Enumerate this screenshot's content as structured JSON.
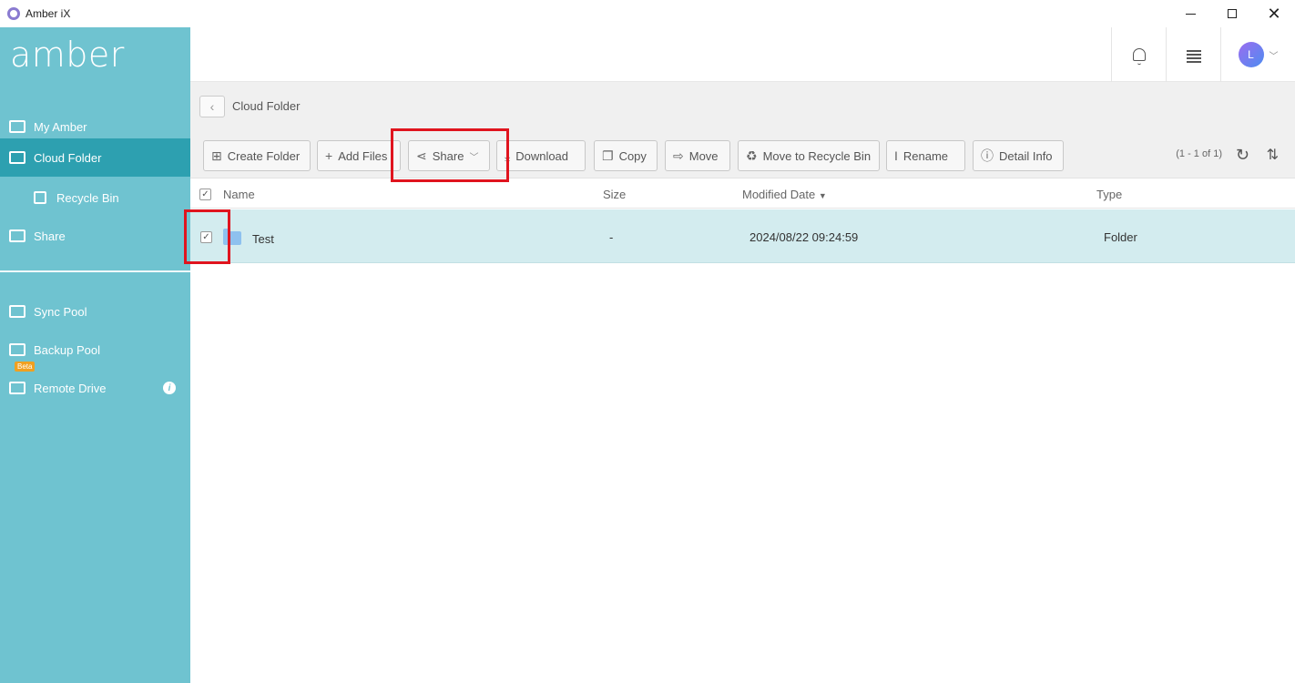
{
  "window": {
    "title": "Amber iX"
  },
  "sidebar": {
    "brand": "amber",
    "items": [
      {
        "label": "My Amber",
        "icon": "monitor-icon"
      },
      {
        "label": "Cloud Folder",
        "icon": "cloud-folder-icon",
        "active": true
      },
      {
        "label": "Recycle Bin",
        "icon": "recycle-bin-icon",
        "sub": true
      },
      {
        "label": "Share",
        "icon": "share-folder-icon"
      },
      {
        "label": "Sync Pool",
        "icon": "sync-icon"
      },
      {
        "label": "Backup Pool",
        "icon": "backup-icon"
      },
      {
        "label": "Remote Drive",
        "icon": "remote-drive-icon",
        "badge": "Beta"
      }
    ]
  },
  "header": {
    "avatar_initial": "L"
  },
  "breadcrumb": {
    "current": "Cloud Folder"
  },
  "toolbar": {
    "create_folder": "Create Folder",
    "add_files": "Add Files",
    "share": "Share",
    "download": "Download",
    "copy": "Copy",
    "move": "Move",
    "recycle": "Move to Recycle Bin",
    "rename": "Rename",
    "detail": "Detail Info",
    "pager": "(1 - 1 of 1)"
  },
  "table": {
    "columns": {
      "name": "Name",
      "size": "Size",
      "modified": "Modified Date",
      "type": "Type"
    },
    "rows": [
      {
        "name": "Test",
        "size": "-",
        "modified": "2024/08/22 09:24:59",
        "type": "Folder",
        "selected": true
      }
    ]
  },
  "colors": {
    "sidebar": "#6fc3d0",
    "sidebar_active": "#2da0b0",
    "row_selected": "#d3ecef",
    "highlight": "#e0141e"
  }
}
